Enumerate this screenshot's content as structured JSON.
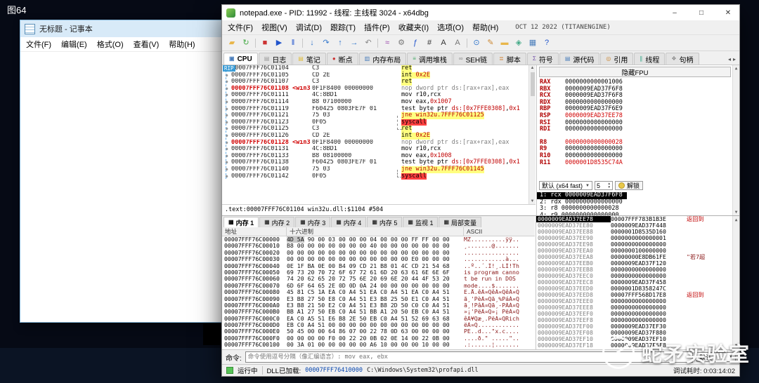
{
  "desktop": {
    "label": "图64"
  },
  "watermark": {
    "text": "蛇矛实验室"
  },
  "notepad": {
    "title": "无标题 - 记事本",
    "menus": [
      "文件(F)",
      "编辑(E)",
      "格式(O)",
      "查看(V)",
      "帮助(H)"
    ]
  },
  "debugger": {
    "title": "notepad.exe - PID: 11992 - 线程: 主线程 3024 - x64dbg",
    "window_buttons": {
      "minimize": "–",
      "maximize": "□",
      "close": "✕"
    },
    "menus": [
      "文件(F)",
      "视图(V)",
      "调试(D)",
      "跟踪(T)",
      "插件(P)",
      "收藏夹(I)",
      "选项(O)",
      "帮助(H)"
    ],
    "build_info": "OCT 12 2022 (TITANENGINE)",
    "toolbar": [
      {
        "name": "open-file-icon",
        "glyph": "▰",
        "color": "#e8b64a"
      },
      {
        "name": "restart-icon",
        "glyph": "↻",
        "color": "#44aa44"
      },
      {
        "sep": true
      },
      {
        "name": "stop-icon",
        "glyph": "■",
        "color": "#cc3333"
      },
      {
        "name": "run-icon",
        "glyph": "▶",
        "color": "#2255cc"
      },
      {
        "name": "pause-icon",
        "glyph": "‖",
        "color": "#2255cc"
      },
      {
        "sep": true
      },
      {
        "name": "step-into-icon",
        "glyph": "↓",
        "color": "#3377cc"
      },
      {
        "name": "step-over-icon",
        "glyph": "↷",
        "color": "#3377cc"
      },
      {
        "name": "step-out-icon",
        "glyph": "↑",
        "color": "#3377cc"
      },
      {
        "name": "run-to-cursor-icon",
        "glyph": "→",
        "color": "#3377cc"
      },
      {
        "name": "back-icon",
        "glyph": "↶",
        "color": "#888888"
      },
      {
        "sep": true
      },
      {
        "name": "trace-icon",
        "glyph": "≈",
        "color": "#9944aa"
      },
      {
        "name": "settings-icon",
        "glyph": "⚙",
        "color": "#777777"
      },
      {
        "name": "function-icon",
        "glyph": "ƒ",
        "color": "#2255cc"
      },
      {
        "name": "hash-icon",
        "glyph": "#",
        "color": "#333333"
      },
      {
        "name": "font-icon",
        "glyph": "A",
        "color": "#333333"
      },
      {
        "name": "sort-az-icon",
        "glyph": "A",
        "color": "#777777"
      },
      {
        "sep": true
      },
      {
        "name": "search-icon",
        "glyph": "⊙",
        "color": "#3377cc"
      },
      {
        "name": "comment-icon",
        "glyph": "✎",
        "color": "#cc8833"
      },
      {
        "name": "highlight-icon",
        "glyph": "▬",
        "color": "#e8b64a"
      },
      {
        "name": "graph-icon",
        "glyph": "◈",
        "color": "#44aa88"
      },
      {
        "name": "memory-map-icon",
        "glyph": "▦",
        "color": "#4a7ebb"
      },
      {
        "name": "help-icon",
        "glyph": "?",
        "color": "#2255cc"
      }
    ],
    "tabs": [
      {
        "key": "cpu",
        "label": "CPU",
        "glyph": "▣",
        "color": "#4a7ebb",
        "active": true
      },
      {
        "key": "log",
        "label": "日志",
        "glyph": "▤",
        "color": "#9a9a9a"
      },
      {
        "key": "notes",
        "label": "笔记",
        "glyph": "▤",
        "color": "#e0bc3a"
      },
      {
        "key": "breakpoints",
        "label": "断点",
        "glyph": "●",
        "color": "#cc3333"
      },
      {
        "key": "memory-map",
        "label": "内存布局",
        "glyph": "▥",
        "color": "#4a7ebb"
      },
      {
        "key": "call-stack",
        "label": "调用堆栈",
        "glyph": "≡",
        "color": "#44aa66"
      },
      {
        "key": "seh",
        "label": "SEH链",
        "glyph": "∞",
        "color": "#888888"
      },
      {
        "key": "script",
        "label": "脚本",
        "glyph": "≣",
        "color": "#d08030"
      },
      {
        "key": "symbols",
        "label": "符号",
        "glyph": "Σ",
        "color": "#7755aa"
      },
      {
        "key": "source",
        "label": "源代码",
        "glyph": "▤",
        "color": "#4a7ebb"
      },
      {
        "key": "references",
        "label": "引用",
        "glyph": "◎",
        "color": "#cc8833"
      },
      {
        "key": "threads",
        "label": "线程",
        "glyph": "∥",
        "color": "#33aa88"
      },
      {
        "key": "handles",
        "label": "句柄",
        "glyph": "❖",
        "color": "#888888"
      }
    ],
    "disasm": {
      "rip_label": "RIP",
      "info_line": ".text:00007FFF76C01104 win32u.dll:$1104 #504",
      "rows": [
        {
          "addr": "00007FFF76C01104",
          "bytes": "C3",
          "hl": "y",
          "ops": [
            {
              "t": "ret",
              "c": "ret"
            }
          ]
        },
        {
          "addr": "00007FFF76C01105",
          "bytes": "CD 2E",
          "hl": "y",
          "ops": [
            {
              "t": "int ",
              "c": "mn"
            },
            {
              "t": "0x2E",
              "c": "num"
            }
          ]
        },
        {
          "addr": "00007FFF76C01107",
          "bytes": "C3",
          "hl": "y",
          "ops": [
            {
              "t": "ret",
              "c": "ret"
            }
          ]
        },
        {
          "addr": "00007FFF76C01108",
          "label": "<win3",
          "addr_red": true,
          "bytes": "0F1F8400 00000000",
          "ops": [
            {
              "t": "nop dword ptr ds:[rax+rax],eax",
              "c": "nop"
            }
          ]
        },
        {
          "addr": "00007FFF76C01111",
          "bytes": "4C:8BD1",
          "ops": [
            {
              "t": "mov r10,rcx",
              "c": "mn"
            }
          ]
        },
        {
          "addr": "00007FFF76C01114",
          "bytes": "B8 07100000",
          "ops": [
            {
              "t": "mov eax,",
              "c": "mn"
            },
            {
              "t": "0x1007",
              "c": "num"
            }
          ]
        },
        {
          "addr": "00007FFF76C01119",
          "bytes": "F60425 0803FE7F 01",
          "ops": [
            {
              "t": "test byte ptr ",
              "c": "mn"
            },
            {
              "t": "ds:[0x7FFE0308]",
              "c": "num"
            },
            {
              "t": ",",
              "c": "mn"
            },
            {
              "t": "0x1",
              "c": "num"
            }
          ]
        },
        {
          "addr": "00007FFF76C01121",
          "bytes": "75 03",
          "hl": "y",
          "ops": [
            {
              "t": "jne win32u.7FFF76C01125",
              "c": "jmp"
            }
          ]
        },
        {
          "addr": "00007FFF76C01123",
          "bytes": "0F05",
          "hl": "r",
          "ops": [
            {
              "t": "syscall",
              "c": "sys"
            }
          ]
        },
        {
          "addr": "00007FFF76C01125",
          "bytes": "C3",
          "hl": "y",
          "ops": [
            {
              "t": "ret",
              "c": "ret"
            }
          ]
        },
        {
          "addr": "00007FFF76C01126",
          "bytes": "CD 2E",
          "hl": "y",
          "ops": [
            {
              "t": "int ",
              "c": "mn"
            },
            {
              "t": "0x2E",
              "c": "num"
            }
          ]
        },
        {
          "addr": "00007FFF76C01128",
          "label": "<win3",
          "addr_red": true,
          "bytes": "0F1F8400 00000000",
          "ops": [
            {
              "t": "nop dword ptr ds:[rax+rax],eax",
              "c": "nop"
            }
          ]
        },
        {
          "addr": "00007FFF76C01131",
          "bytes": "4C:8BD1",
          "ops": [
            {
              "t": "mov r10,rcx",
              "c": "mn"
            }
          ]
        },
        {
          "addr": "00007FFF76C01133",
          "bytes": "B8 08100000",
          "ops": [
            {
              "t": "mov eax,",
              "c": "mn"
            },
            {
              "t": "0x1008",
              "c": "num"
            }
          ]
        },
        {
          "addr": "00007FFF76C01138",
          "bytes": "F60425 0803FE7F 01",
          "ops": [
            {
              "t": "test byte ptr ",
              "c": "mn"
            },
            {
              "t": "ds:[0x7FFE0308]",
              "c": "num"
            },
            {
              "t": ",",
              "c": "mn"
            },
            {
              "t": "0x1",
              "c": "num"
            }
          ]
        },
        {
          "addr": "00007FFF76C01140",
          "bytes": "75 03",
          "hl": "y",
          "ops": [
            {
              "t": "jne win32u.7FFF76C01145",
              "c": "jmp"
            }
          ]
        },
        {
          "addr": "00007FFF76C01142",
          "bytes": "0F05",
          "hl": "r",
          "ops": [
            {
              "t": "syscall",
              "c": "sys"
            }
          ]
        }
      ]
    },
    "registers": {
      "hide_fpu": "隐藏FPU",
      "rows": [
        {
          "name": "RAX",
          "value": "0000000000001006"
        },
        {
          "name": "RBX",
          "value": "0000009EAD37F6F8"
        },
        {
          "name": "RCX",
          "value": "0000009EAD37F6F8"
        },
        {
          "name": "RDX",
          "value": "0000000000000000"
        },
        {
          "name": "RBP",
          "value": "0000009EAD37F6E9"
        },
        {
          "name": "RSP",
          "value": "0000009EAD37EE78",
          "red": true
        },
        {
          "name": "RSI",
          "value": "0000000000000000"
        },
        {
          "name": "RDI",
          "value": "0000000000000000"
        },
        {
          "name": "R8",
          "value": "0000000000000028",
          "red": true,
          "gap": true
        },
        {
          "name": "R9",
          "value": "0000000000000000"
        },
        {
          "name": "R10",
          "value": "0000000000000000"
        },
        {
          "name": "R11",
          "value": "0000001D8535C74A",
          "red": true
        }
      ],
      "convention": {
        "default_label": "默认 (x64 fast)",
        "count": "5",
        "unlock_label": "解锁"
      },
      "args": [
        {
          "text": "1: rcx 0000009EAD37F6F8",
          "selected": true
        },
        {
          "text": "2: rdx 0000000000000000"
        },
        {
          "text": "3: r8 0000000000000028"
        },
        {
          "text": "4: r9 0000000000000000"
        }
      ]
    },
    "dump": {
      "tabs": [
        {
          "key": "mem1",
          "label": "内存 1",
          "active": true
        },
        {
          "key": "mem2",
          "label": "内存 2"
        },
        {
          "key": "mem3",
          "label": "内存 3"
        },
        {
          "key": "mem4",
          "label": "内存 4"
        },
        {
          "key": "mem5",
          "label": "内存 5"
        },
        {
          "key": "watch1",
          "label": "监视 1"
        },
        {
          "key": "locals",
          "label": "局部变量"
        }
      ],
      "headers": [
        "地址",
        "十六进制",
        "ASCII"
      ],
      "rows": [
        {
          "addr": "00007FFF76C00000",
          "hex": "4D 5A 90 00 03 00 00 00 04 00 00 00 FF FF 00 00",
          "ascii": "MZ..........ÿÿ..",
          "mz": true
        },
        {
          "addr": "00007FFF76C00010",
          "hex": "B8 00 00 00 00 00 00 00 40 00 00 00 00 00 00 00",
          "ascii": "¸.......@......."
        },
        {
          "addr": "00007FFF76C00020",
          "hex": "00 00 00 00 00 00 00 00 00 00 00 00 00 00 00 00",
          "ascii": "................"
        },
        {
          "addr": "00007FFF76C00030",
          "hex": "00 00 00 00 00 00 00 00 00 00 00 00 E0 00 00 00",
          "ascii": "............à..."
        },
        {
          "addr": "00007FFF76C00040",
          "hex": "0E 1F BA 0E 00 B4 09 CD 21 B8 01 4C CD 21 54 68",
          "ascii": "..º..´.Í!¸.LÍ!Th"
        },
        {
          "addr": "00007FFF76C00050",
          "hex": "69 73 20 70 72 6F 67 72 61 6D 20 63 61 6E 6E 6F",
          "ascii": "is program canno"
        },
        {
          "addr": "00007FFF76C00060",
          "hex": "74 20 62 65 20 72 75 6E 20 69 6E 20 44 4F 53 20",
          "ascii": "t be run in DOS "
        },
        {
          "addr": "00007FFF76C00070",
          "hex": "6D 6F 64 65 2E 0D 0D 0A 24 00 00 00 00 00 00 00",
          "ascii": "mode....$......."
        },
        {
          "addr": "00007FFF76C00080",
          "hex": "45 81 C5 1A EA C0 A4 51 EA C0 A4 51 EA C0 A4 51",
          "ascii": "E.Å.êÀ¤QêÀ¤QêÀ¤Q"
        },
        {
          "addr": "00007FFF76C00090",
          "hex": "E3 B8 27 50 E8 C0 A4 51 E3 B8 25 50 E1 C0 A4 51",
          "ascii": "ã¸'PèÀ¤Qã¸%PáÀ¤Q"
        },
        {
          "addr": "00007FFF76C000A0",
          "hex": "E3 B8 21 50 E2 C0 A4 51 E3 B8 2D 50 C0 C0 A4 51",
          "ascii": "ã¸!PâÀ¤Qã¸-PÀÀ¤Q"
        },
        {
          "addr": "00007FFF76C000B0",
          "hex": "BB A1 27 50 EB C0 A4 51 BB A1 20 50 EB C0 A4 51",
          "ascii": "»¡'PëÀ¤Q»¡ PëÀ¤Q"
        },
        {
          "addr": "00007FFF76C000C0",
          "hex": "EA C0 A5 51 E6 B8 2E 50 EB C0 A4 51 52 69 63 68",
          "ascii": "êÀ¥Qæ¸.PëÀ¤QRich"
        },
        {
          "addr": "00007FFF76C000D0",
          "hex": "EB C0 A4 51 00 00 00 00 00 00 00 00 00 00 00 00",
          "ascii": "ëÀ¤Q............"
        },
        {
          "addr": "00007FFF76C000E0",
          "hex": "50 45 00 00 64 86 07 00 22 78 0D 63 00 00 00 00",
          "ascii": "PE..d...\"x.c...."
        },
        {
          "addr": "00007FFF76C000F0",
          "hex": "00 00 00 00 F0 00 22 20 0B 02 0E 14 00 22 0B 00",
          "ascii": "....ð.\" .....\".."
        },
        {
          "addr": "00007FFF76C00100",
          "hex": "00 3A 01 00 00 00 00 00 A6 10 00 00 00 10 00 00",
          "ascii": ".:......¦......."
        }
      ]
    },
    "stack": {
      "rows": [
        {
          "addr": "0000009EAD37EE78",
          "value": "00007FFF783B1B3E",
          "comment": "返回到",
          "selected": true
        },
        {
          "addr": "0000009EAD37EE80",
          "value": "0000009EAD37F448"
        },
        {
          "addr": "0000009EAD37EE88",
          "value": "0000001D8535D160"
        },
        {
          "addr": "0000009EAD37EE90",
          "value": "0000000000000001"
        },
        {
          "addr": "0000009EAD37EE98",
          "value": "0000000000000000"
        },
        {
          "addr": "0000009EAD37EEA0",
          "value": "0000000100000000"
        },
        {
          "addr": "0000009EAD37EEA8",
          "value": "00000000E8DB61FE",
          "comment": "\"若7超",
          "str": true
        },
        {
          "addr": "0000009EAD37EEB0",
          "value": "0000009EAD37F120"
        },
        {
          "addr": "0000009EAD37EEB8",
          "value": "0000000000000000"
        },
        {
          "addr": "0000009EAD37EEC0",
          "value": "0000000000000000"
        },
        {
          "addr": "0000009EAD37EEC8",
          "value": "0000009EAD37F458"
        },
        {
          "addr": "0000009EAD37EED0",
          "value": "0000001D8358247C"
        },
        {
          "addr": "0000009EAD37EED8",
          "value": "00007FFF568D17E8",
          "comment": "返回到"
        },
        {
          "addr": "0000009EAD37EEE0",
          "value": "0000000000000000"
        },
        {
          "addr": "0000009EAD37EEE8",
          "value": "0000000000000000"
        },
        {
          "addr": "0000009EAD37EEF0",
          "value": "0000000000000000"
        },
        {
          "addr": "0000009EAD37EEF8",
          "value": "0000000000000000"
        },
        {
          "addr": "0000009EAD37EF00",
          "value": "0000009EAD37EF30"
        },
        {
          "addr": "0000009EAD37EF08",
          "value": "0000009EAD37F880"
        },
        {
          "addr": "0000009EAD37EF10",
          "value": "0000009EAD37EF10"
        },
        {
          "addr": "0000009EAD37EF18",
          "value": "0000009EAD37F6F8"
        }
      ]
    },
    "command": {
      "label": "命令:",
      "placeholder": "命令使用逗号分隔（像汇编语言）: mov eax, ebx",
      "mode": "默认"
    },
    "status": {
      "state": "运行中",
      "loaded_prefix": "DLL已加载:",
      "loaded_addr": "00007FFF76410000",
      "loaded_path": "C:\\Windows\\System32\\profapi.dll",
      "time_label": "调试耗时:",
      "time": "0:03:14:02"
    }
  }
}
